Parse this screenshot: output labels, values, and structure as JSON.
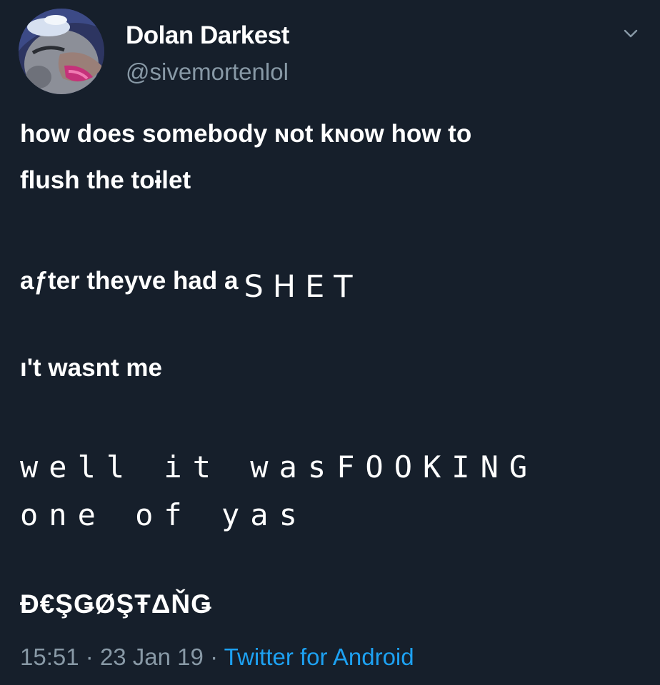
{
  "colors": {
    "background": "#161f2b",
    "text": "#ffffff",
    "secondary": "#8899a6",
    "link": "#1da1f2"
  },
  "author": {
    "display_name": "Dolan Darkest",
    "handle": "@sivemortenlol",
    "avatar_icon": "dolan-duck-avatar"
  },
  "menu_icon": "chevron-down-icon",
  "tweet": {
    "line1": "how does somebody ɴot kɴow how to",
    "line2": "flush the toɨlet",
    "line3_start": "aƒter theyve had a",
    "line3_emphasis": "SHET",
    "line4": "ı't wasnt me",
    "line5": "well it wasFOOKING",
    "line6": "one of yas",
    "line7": "Đ€ŞǤØŞŦΔŇǤ"
  },
  "meta": {
    "time": "15:51",
    "date": "23 Jan 19",
    "separator": "·",
    "source": "Twitter for Android"
  }
}
